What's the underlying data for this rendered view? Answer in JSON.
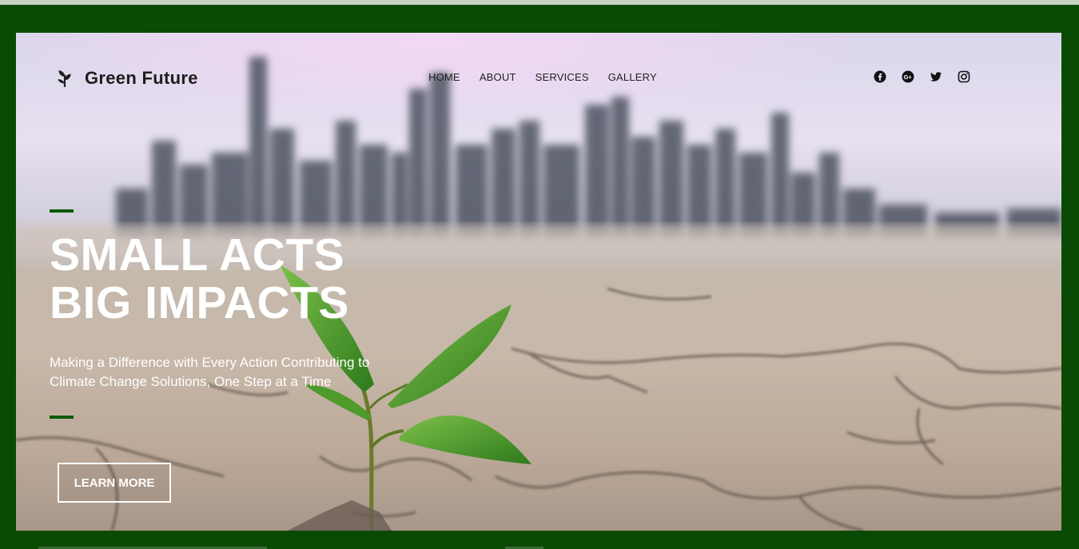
{
  "brand": {
    "name": "Green Future",
    "icon": "sprout-icon"
  },
  "nav": {
    "items": [
      "HOME",
      "ABOUT",
      "SERVICES",
      "GALLERY"
    ]
  },
  "social": {
    "icons": [
      "facebook-icon",
      "google-plus-icon",
      "twitter-icon",
      "instagram-icon"
    ]
  },
  "hero": {
    "headline_line1": "SMALL ACTS",
    "headline_line2": "BIG IMPACTS",
    "subtext": "Making a Difference with Every Action Contributing to Climate Change Solutions, One Step at a Time",
    "cta_label": "LEARN MORE"
  },
  "colors": {
    "frame": "#0b4a05",
    "accent": "#0b5a06",
    "text_light": "#ffffff",
    "text_dark": "#1d1d1d"
  }
}
